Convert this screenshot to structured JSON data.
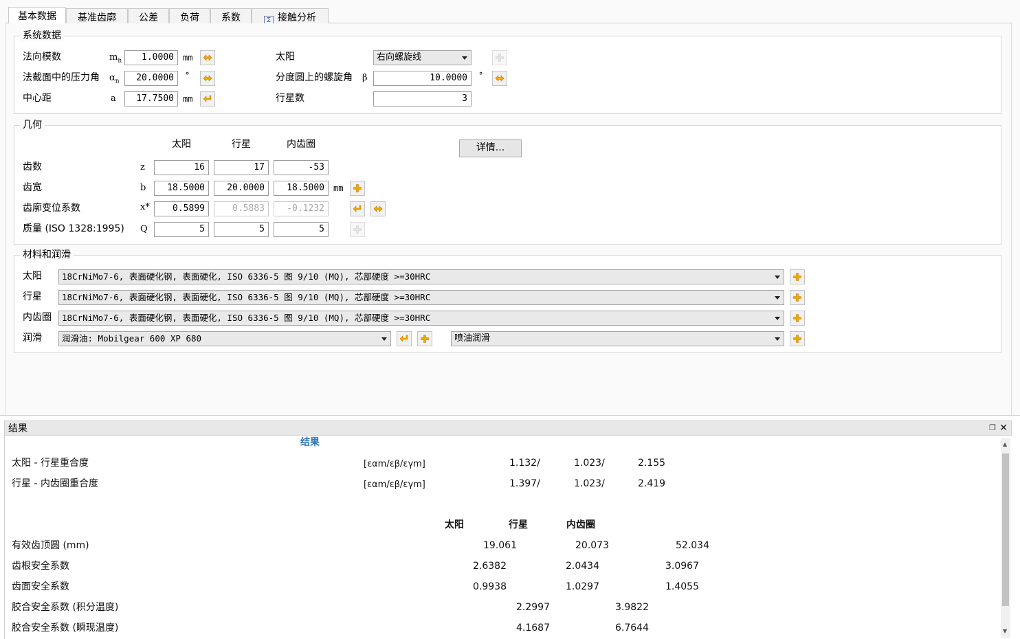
{
  "tabs": [
    {
      "label": "基本数据",
      "active": true
    },
    {
      "label": "基准齿廓",
      "active": false
    },
    {
      "label": "公差",
      "active": false
    },
    {
      "label": "负荷",
      "active": false
    },
    {
      "label": "系数",
      "active": false
    },
    {
      "label": "接触分析",
      "active": false,
      "icon": "calc-icon"
    }
  ],
  "system": {
    "title": "系统数据",
    "normal_module": {
      "label": "法向模数",
      "symbol": "mn",
      "value": "1.0000",
      "unit": "mm"
    },
    "pressure_angle": {
      "label": "法截面中的压力角",
      "symbol": "αn",
      "value": "20.0000",
      "unit": "°"
    },
    "center_distance": {
      "label": "中心距",
      "symbol": "a",
      "value": "17.7500",
      "unit": "mm"
    },
    "sun": {
      "label": "太阳",
      "value": "右向螺旋线"
    },
    "helix_angle": {
      "label": "分度圆上的螺旋角",
      "symbol": "β",
      "value": "10.0000",
      "unit": "°"
    },
    "planet_count": {
      "label": "行星数",
      "value": "3"
    }
  },
  "geometry": {
    "title": "几何",
    "columns": [
      "太阳",
      "行星",
      "内齿圈"
    ],
    "details_button": "详情...",
    "rows": [
      {
        "label": "齿数",
        "symbol": "z",
        "values": [
          "16",
          "17",
          "-53"
        ],
        "unit": ""
      },
      {
        "label": "齿宽",
        "symbol": "b",
        "values": [
          "18.5000",
          "20.0000",
          "18.5000"
        ],
        "unit": "mm"
      },
      {
        "label": "齿廓变位系数",
        "symbol": "x*",
        "values": [
          "0.5899",
          "0.5883",
          "-0.1232"
        ],
        "unit": ""
      },
      {
        "label": "质量 (ISO 1328:1995)",
        "symbol": "Q",
        "values": [
          "5",
          "5",
          "5"
        ],
        "unit": ""
      }
    ]
  },
  "materials": {
    "title": "材料和润滑",
    "rows": [
      {
        "label": "太阳",
        "value": "18CrNiMo7-6, 表面硬化钢, 表面硬化, ISO 6336-5 图 9/10 (MQ), 芯部硬度 >=30HRC"
      },
      {
        "label": "行星",
        "value": "18CrNiMo7-6, 表面硬化钢, 表面硬化, ISO 6336-5 图 9/10 (MQ), 芯部硬度 >=30HRC"
      },
      {
        "label": "内齿圈",
        "value": "18CrNiMo7-6, 表面硬化钢, 表面硬化, ISO 6336-5 图 9/10 (MQ), 芯部硬度 >=30HRC"
      }
    ],
    "lubrication": {
      "label": "润滑",
      "oil": "润滑油: Mobilgear 600 XP 680",
      "method": "喷油润滑"
    }
  },
  "results": {
    "pane_title": "结果",
    "heading": "结果",
    "contact_ratios": [
      {
        "label": "太阳 - 行星重合度",
        "symbol": "[εαm/εβ/εγm]",
        "values": [
          "1.132/",
          "1.023/",
          "2.155"
        ]
      },
      {
        "label": "行星 - 内齿圈重合度",
        "symbol": "[εαm/εβ/εγm]",
        "values": [
          "1.397/",
          "1.023/",
          "2.419"
        ]
      }
    ],
    "columns": [
      "太阳",
      "行星",
      "内齿圈"
    ],
    "tip_diameter": {
      "label": "有效齿顶圆 (mm)",
      "values": [
        "19.061",
        "20.073",
        "52.034"
      ]
    },
    "root_safety": {
      "label": "齿根安全系数",
      "values": [
        "2.6382",
        "2.0434",
        "3.0967"
      ]
    },
    "flank_safety": {
      "label": "齿面安全系数",
      "values": [
        "0.9938",
        "1.0297",
        "1.4055"
      ]
    },
    "scuffing_integral": {
      "label": "胶合安全系数 (积分温度)",
      "values": [
        "2.2997",
        "3.9822"
      ]
    },
    "scuffing_flash": {
      "label": "胶合安全系数 (瞬现温度)",
      "values": [
        "4.1687",
        "6.7644"
      ]
    }
  }
}
